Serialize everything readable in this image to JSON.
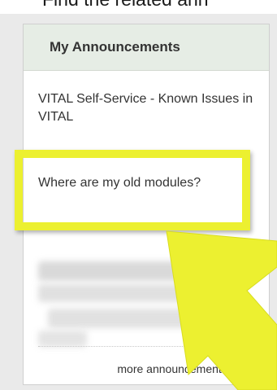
{
  "caption": {
    "text": "Find the related ann"
  },
  "panel": {
    "title": "My Announcements",
    "announcements": [
      {
        "text": "VITAL Self-Service - Known Issues in VITAL"
      },
      {
        "text": "Where are my old modules?"
      }
    ],
    "more_link": "more announcements...",
    "more_arrow": "⟶"
  },
  "colors": {
    "highlight": "#ecf030",
    "header_bg": "#e6ede5",
    "panel_bg": "#eaeaea"
  }
}
